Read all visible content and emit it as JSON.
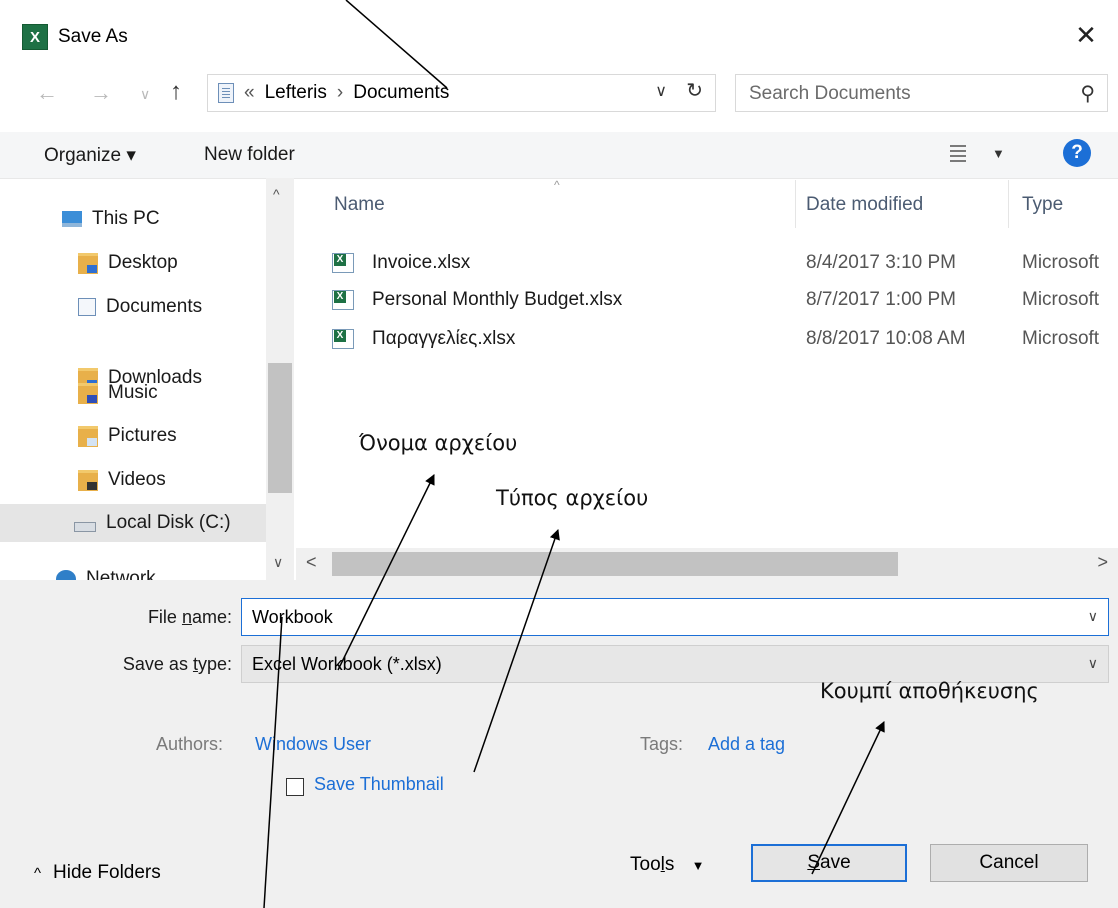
{
  "window": {
    "title": "Save As",
    "app_icon": "excel-icon",
    "close_glyph": "✕"
  },
  "nav": {
    "back": "←",
    "forward": "→",
    "recent": "∨",
    "up": "↑"
  },
  "address": {
    "prefix": "«",
    "crumbs": [
      "Lefteris",
      "Documents"
    ],
    "separator": "›",
    "dropdown": "∨",
    "refresh": "↻"
  },
  "search": {
    "placeholder": "Search Documents",
    "icon": "⚲"
  },
  "toolbar": {
    "organize": "Organize ▾",
    "new_folder": "New folder",
    "view_drop": "▼",
    "help": "?"
  },
  "sidebar": {
    "items": [
      {
        "label": "This PC",
        "icon": "pc"
      },
      {
        "label": "Desktop",
        "icon": "folder-desktop"
      },
      {
        "label": "Documents",
        "icon": "folder-documents"
      },
      {
        "label": "Downloads",
        "icon": "folder-downloads"
      },
      {
        "label": "Music",
        "icon": "folder-music"
      },
      {
        "label": "Pictures",
        "icon": "folder-pictures"
      },
      {
        "label": "Videos",
        "icon": "folder-videos"
      },
      {
        "label": "Local Disk (C:)",
        "icon": "disk",
        "selected": true
      },
      {
        "label": "Network",
        "icon": "network"
      }
    ],
    "scroll_up": "^",
    "scroll_down": "∨"
  },
  "files": {
    "columns": [
      "Name",
      "Date modified",
      "Type"
    ],
    "rows": [
      {
        "name": "Invoice.xlsx",
        "date": "8/4/2017 3:10 PM",
        "type": "Microsoft"
      },
      {
        "name": "Personal Monthly Budget.xlsx",
        "date": "8/7/2017 1:00 PM",
        "type": "Microsoft"
      },
      {
        "name": "Παραγγελίες.xlsx",
        "date": "8/8/2017 10:08 AM",
        "type": "Microsoft"
      }
    ],
    "hscroll_left": "<",
    "hscroll_right": ">"
  },
  "form": {
    "file_name_label_pre": "File ",
    "file_name_label_u": "n",
    "file_name_label_post": "ame:",
    "file_name_value": "Workbook",
    "save_type_label_pre": "Save as ",
    "save_type_label_u": "t",
    "save_type_label_post": "ype:",
    "save_type_value": "Excel Workbook (*.xlsx)",
    "dropdown": "∨",
    "authors_label": "Authors:",
    "authors_value": "Windows User",
    "tags_label": "Tags:",
    "tags_value": "Add a tag",
    "thumbnail_label": "Save Thumbnail",
    "thumbnail_checked": false
  },
  "footer": {
    "hide_folders": "Hide Folders",
    "hide_glyph": "^",
    "tools_pre": "Too",
    "tools_u": "l",
    "tools_post": "s",
    "tools_drop": "▼",
    "save_u": "S",
    "save_post": "ave",
    "cancel": "Cancel"
  },
  "annotations": {
    "file_name": "Όνομα αρχείου",
    "file_type": "Τύπος αρχείου",
    "save_button": "Κουμπί αποθήκευσης"
  },
  "colors": {
    "accent": "#1c6fd6",
    "excel_green": "#1e7145",
    "selected_bg": "#e5e5e5"
  }
}
